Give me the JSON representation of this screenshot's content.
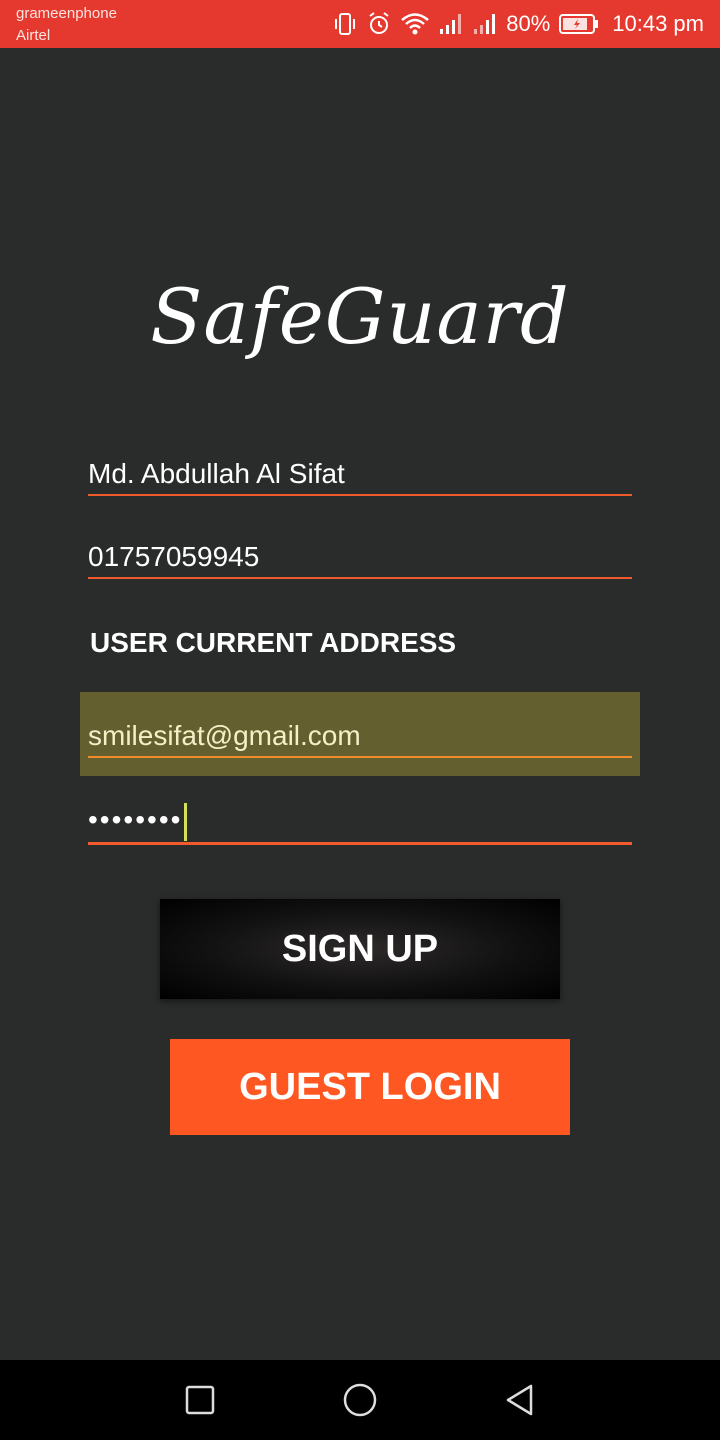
{
  "status_bar": {
    "carrier_1": "grameenphone",
    "carrier_2": "Airtel",
    "battery": "80%",
    "time": "10:43 pm",
    "icons": [
      "vibrate-icon",
      "alarm-icon",
      "wifi-icon",
      "signal-icon",
      "signal-icon",
      "battery-icon"
    ],
    "color": "#e5392f"
  },
  "app": {
    "logo_text": "SafeGuard"
  },
  "form": {
    "name_value": "Md. Abdullah Al Sifat",
    "phone_value": "01757059945",
    "address_label": "USER CURRENT ADDRESS",
    "email_value": "smilesifat@gmail.com",
    "password_value": "••••••••"
  },
  "buttons": {
    "signup_label": "SIGN UP",
    "guest_label": "GUEST LOGIN"
  },
  "colors": {
    "background": "#2a2b2b",
    "accent": "#ff5722",
    "email_highlight": "#645f2f"
  },
  "nav_bar": {
    "icons": [
      "recent-apps-icon",
      "home-icon",
      "back-icon"
    ]
  }
}
